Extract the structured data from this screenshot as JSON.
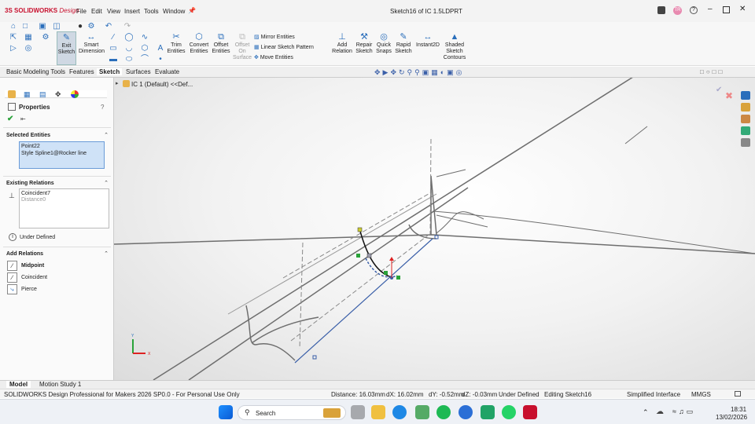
{
  "app": {
    "brand": "SOLIDWORKS",
    "brand_suffix": "Design",
    "window_title": "Sketch16 of IC 1.5LDPRT"
  },
  "menus": [
    "File",
    "Edit",
    "View",
    "Insert",
    "Tools",
    "Window"
  ],
  "ribbon": {
    "exit_sketch": "Exit Sketch",
    "smart_dimension": "Smart Dimension",
    "trim_entities": "Trim Entities",
    "convert_entities": "Convert Entities",
    "offset_entities": "Offset Entities",
    "offset_on_surface": "Offset On Surface",
    "mirror_entities": "Mirror Entities",
    "linear_sketch_pattern": "Linear Sketch Pattern",
    "move_entities": "Move Entities",
    "add_relation": "Add Relation",
    "repair_sketch": "Repair Sketch",
    "quick_snaps": "Quick Snaps",
    "rapid_sketch": "Rapid Sketch",
    "instant2d": "Instant2D",
    "shaded_sketch_contours": "Shaded Sketch Contours"
  },
  "tabs": [
    "Basic Modeling Tools",
    "Features",
    "Sketch",
    "Surfaces",
    "Evaluate"
  ],
  "active_tab": "Sketch",
  "tree": {
    "label": "IC 1 (Default) <<Def..."
  },
  "properties": {
    "title": "Properties",
    "selected_entities_header": "Selected Entities",
    "selected_entities": [
      "Point22",
      "Style Spline1@Rocker line"
    ],
    "existing_relations_header": "Existing Relations",
    "existing_relations": [
      "Coincident7",
      "Distance0"
    ],
    "status": "Under Defined",
    "add_relations_header": "Add Relations",
    "add_relations": [
      "Midpoint",
      "Coincident",
      "Pierce"
    ]
  },
  "bottom_tabs": [
    "Model",
    "Motion Study 1"
  ],
  "status": {
    "product": "SOLIDWORKS Design Professional for Makers 2026 SP0.0 - For Personal Use Only",
    "distance": "Distance: 16.03mm",
    "dx": "dX: 16.02mm",
    "dy": "dY: -0.52mm",
    "dz": "dZ: -0.03mm",
    "definition": "Under Defined",
    "editing": "Editing Sketch16",
    "interface": "Simplified Interface",
    "units": "MMGS"
  },
  "taskbar": {
    "search": "Search",
    "time": "18:31",
    "date": "13/02/2026"
  },
  "colors": {
    "brand_red": "#c8102e",
    "sketch_blue": "#3a5fa8",
    "selected_box": "#cfe2f7",
    "point_green": "#2aa33a"
  }
}
